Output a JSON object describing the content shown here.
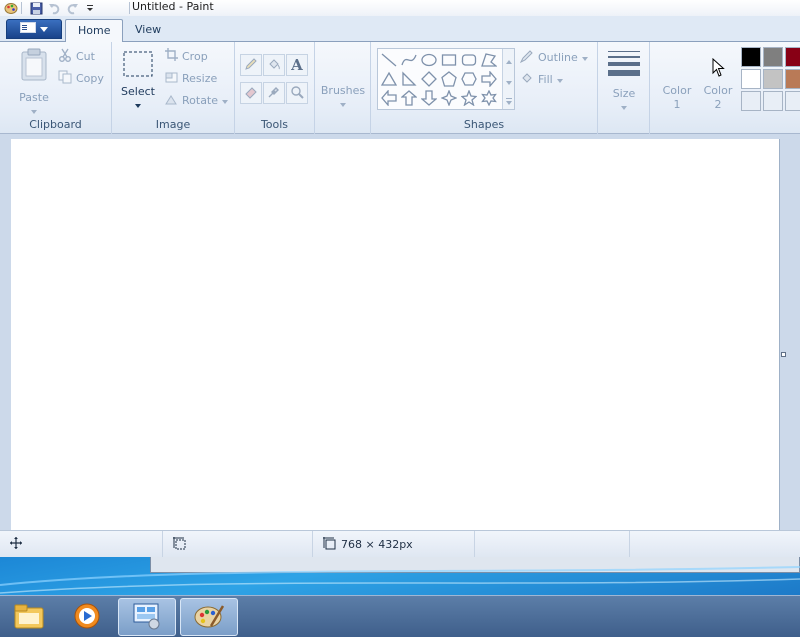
{
  "window": {
    "title": "Untitled - Paint"
  },
  "tabs": {
    "file_label": "",
    "home": "Home",
    "view": "View"
  },
  "ribbon": {
    "clipboard": {
      "label": "Clipboard",
      "paste": "Paste",
      "cut": "Cut",
      "copy": "Copy"
    },
    "image": {
      "label": "Image",
      "select": "Select",
      "crop": "Crop",
      "resize": "Resize",
      "rotate": "Rotate"
    },
    "tools": {
      "label": "Tools"
    },
    "brushes": {
      "label": "Brushes"
    },
    "shapes": {
      "label": "Shapes",
      "outline": "Outline",
      "fill": "Fill"
    },
    "size": {
      "label": "Size"
    },
    "color1": {
      "line1": "Color",
      "line2": "1"
    },
    "color2": {
      "line1": "Color",
      "line2": "2"
    },
    "palette": {
      "row1": [
        "#000000",
        "#7f7f7f",
        "#880015"
      ],
      "row2": [
        "#ffffff",
        "#c3c3c3",
        "#b97a57"
      ],
      "row3": [
        "#e8eef6",
        "#e8eef6",
        "#e8eef6"
      ]
    }
  },
  "status": {
    "dimensions": "768 × 432px"
  },
  "taskbar": {
    "items": [
      "file-explorer",
      "media-player",
      "remote-desktop",
      "paint"
    ]
  },
  "colors": {
    "accent": "#19438a",
    "ribbon_bg": "#e7eef8",
    "workspace": "#ccd9ea"
  }
}
